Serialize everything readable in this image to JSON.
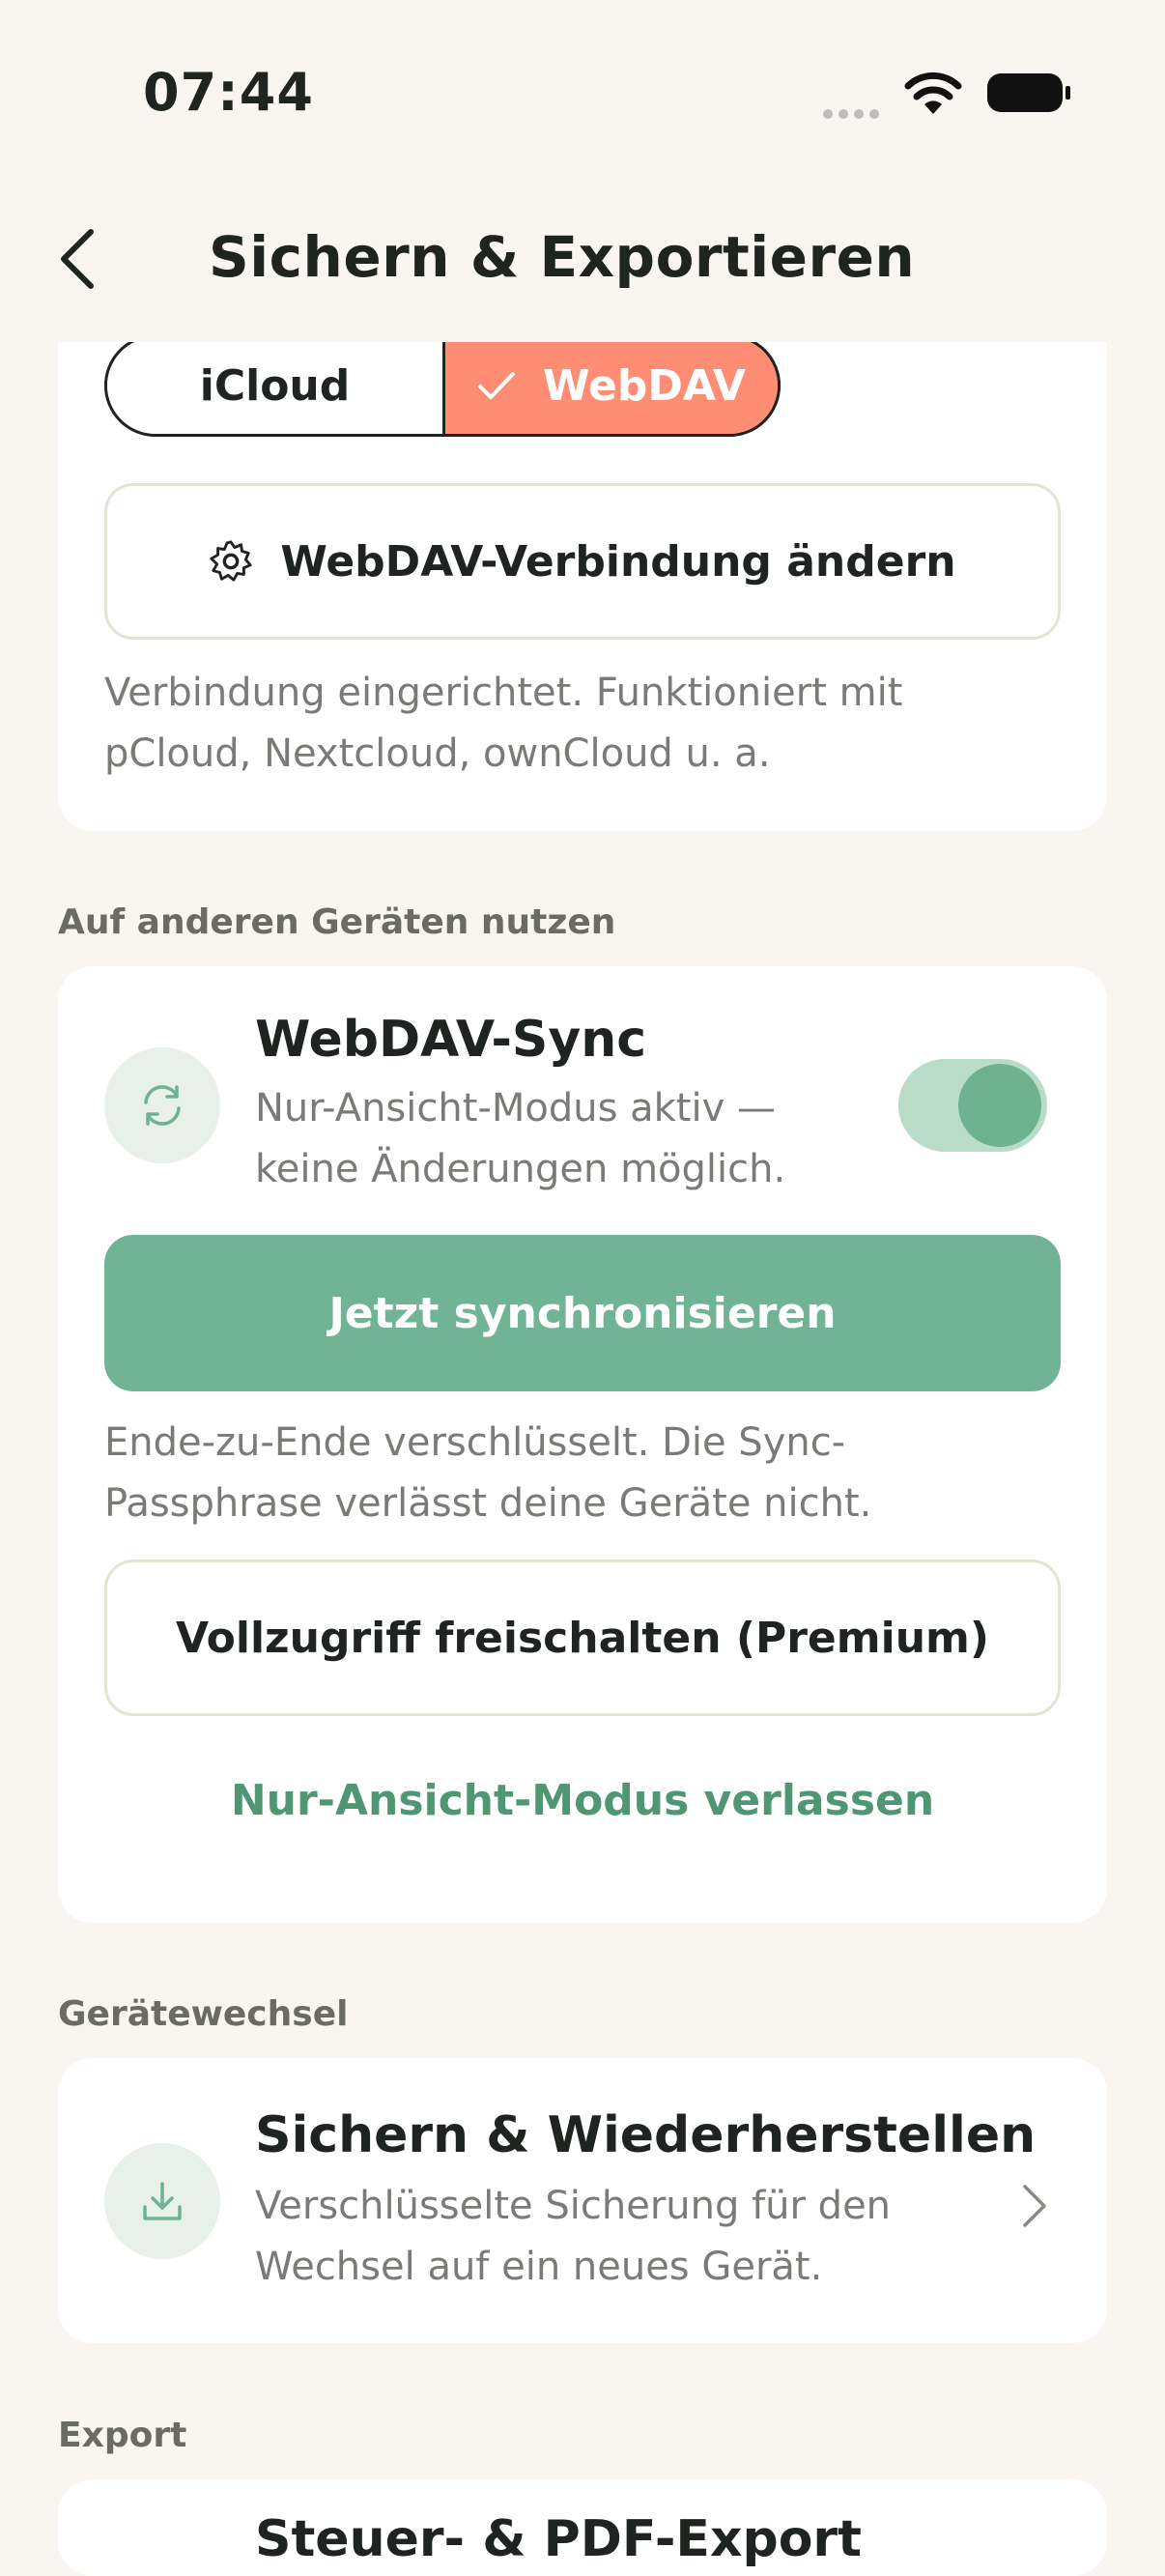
{
  "status_bar": {
    "time": "07:44"
  },
  "header": {
    "title": "Sichern & Exportieren"
  },
  "storage": {
    "option_icloud": "iCloud",
    "option_webdav": "WebDAV",
    "change_connection_label": "WebDAV-Verbindung ändern",
    "description": "Verbindung eingerichtet. Funktioniert mit pCloud, Nextcloud, ownCloud u. a."
  },
  "sections": {
    "other_devices": "Auf anderen Geräten nutzen",
    "device_change": "Gerätewechsel",
    "export": "Export"
  },
  "sync": {
    "title": "WebDAV-Sync",
    "subtitle": "Nur-Ansicht-Modus aktiv — keine Änderungen möglich.",
    "toggle_on": true,
    "sync_now_label": "Jetzt synchronisieren",
    "encryption_note": "Ende-zu-Ende verschlüsselt. Die Sync-Passphrase verlässt deine Geräte nicht.",
    "unlock_label": "Vollzugriff freischalten (Premium)",
    "leave_view_mode_label": "Nur-Ansicht-Modus verlassen"
  },
  "backup": {
    "title": "Sichern & Wiederherstellen",
    "subtitle": "Verschlüsselte Sicherung für den Wechsel auf ein neues Gerät."
  },
  "export_row": {
    "title": "Steuer- & PDF-Export"
  },
  "colors": {
    "background": "#f9f6f1",
    "accent_green": "#70b395",
    "accent_coral": "#ff8d73",
    "link_green": "#4f9672"
  }
}
